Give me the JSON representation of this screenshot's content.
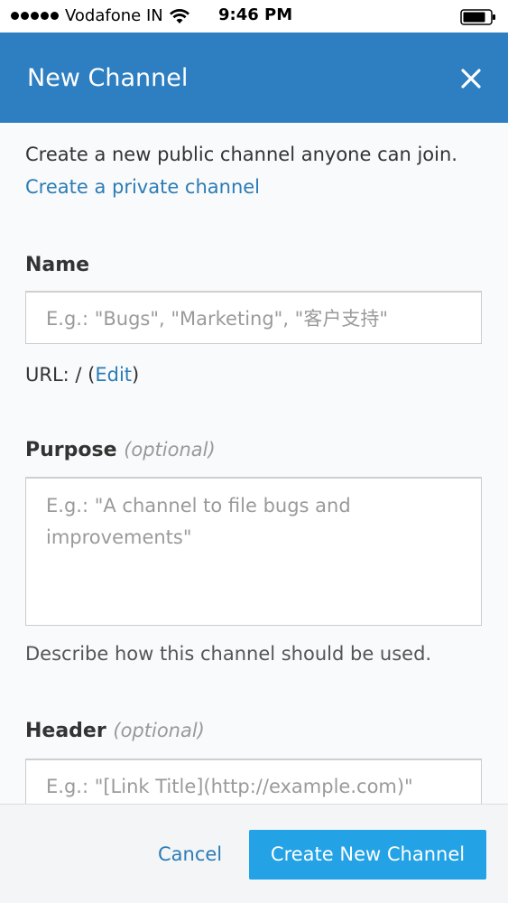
{
  "status_bar": {
    "carrier": "Vodafone IN",
    "time": "9:46 PM",
    "signal_icon": "signal-dots-icon",
    "wifi_icon": "wifi-icon",
    "battery_icon": "battery-icon"
  },
  "header": {
    "title": "New Channel",
    "close_icon": "close-icon",
    "color": "#2d7fc1"
  },
  "intro": {
    "text": "Create a new public channel anyone can join.",
    "private_link": "Create a private channel"
  },
  "name": {
    "label": "Name",
    "placeholder": "E.g.: \"Bugs\", \"Marketing\", \"客户支持\"",
    "url_prefix": "URL: / (",
    "url_edit": "Edit",
    "url_suffix": ")"
  },
  "purpose": {
    "label": "Purpose",
    "optional": "(optional)",
    "placeholder": "E.g.: \"A channel to file bugs and improvements\"",
    "help": "Describe how this channel should be used."
  },
  "header_field": {
    "label": "Header",
    "optional": "(optional)",
    "placeholder": "E.g.: \"[Link Title](http://example.com)\""
  },
  "footer": {
    "cancel": "Cancel",
    "create": "Create New Channel",
    "create_color": "#23a2e6"
  }
}
